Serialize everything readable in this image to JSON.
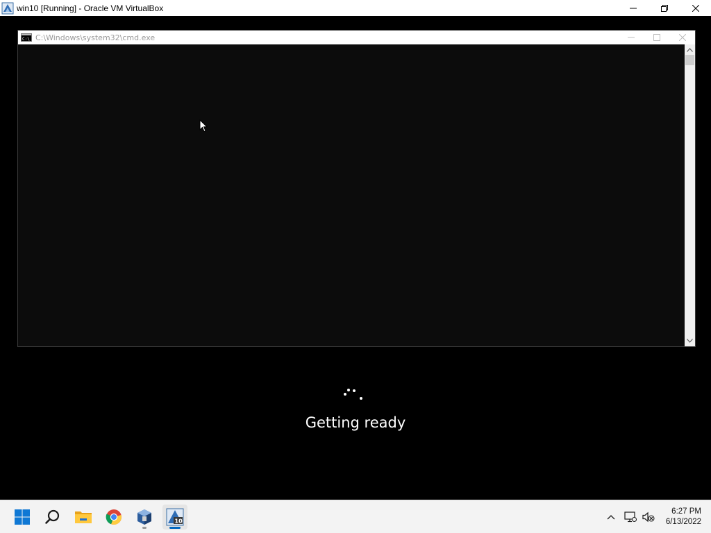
{
  "host_window": {
    "title": "win10 [Running] - Oracle VM VirtualBox",
    "app_icon": "virtualbox-icon"
  },
  "cmd_window": {
    "title": "C:\\Windows\\system32\\cmd.exe",
    "icon": "cmd-icon"
  },
  "boot_status": {
    "message": "Getting ready"
  },
  "taskbar": {
    "items": [
      "start-icon",
      "search-icon",
      "file-explorer-icon",
      "chrome-icon",
      "virtualbox-icon",
      "win10-vm-icon"
    ],
    "tray_icons": [
      "chevron-up-icon",
      "network-icon",
      "volume-muted-icon"
    ],
    "clock": {
      "time": "6:27 PM",
      "date": "6/13/2022"
    }
  },
  "colors": {
    "accent": "#0067c0",
    "console_bg": "#0c0c0c"
  }
}
